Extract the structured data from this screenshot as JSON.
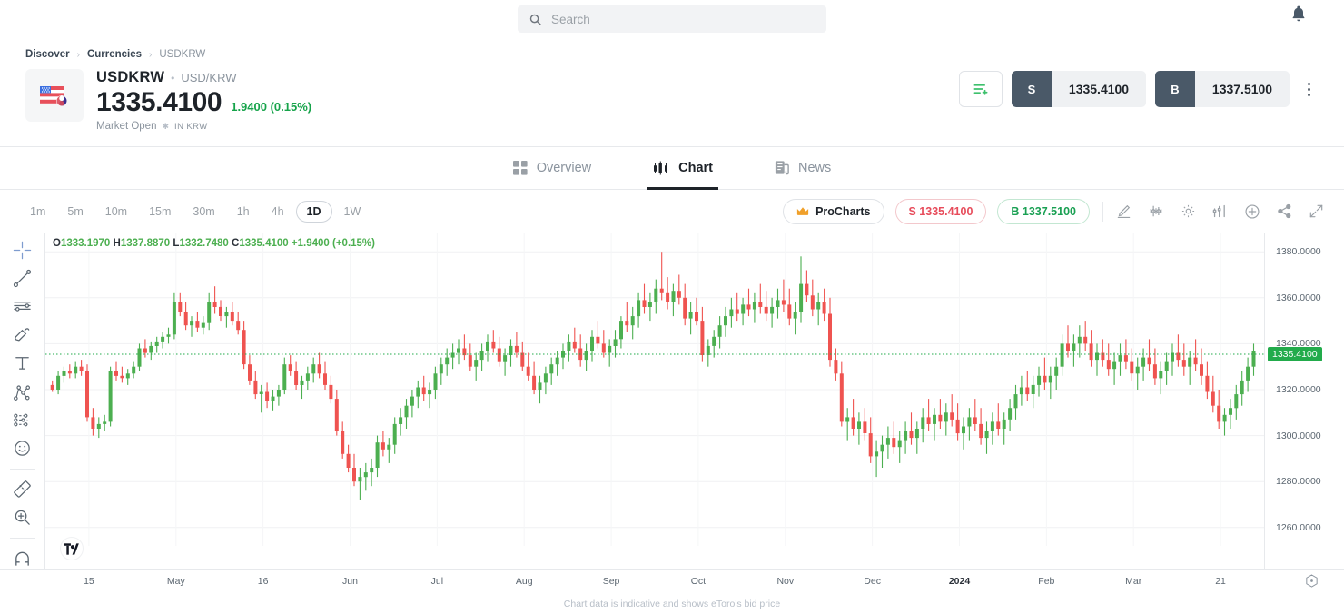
{
  "topbar": {
    "search_placeholder": "Search",
    "search_icon": "search-icon",
    "bell_icon": "notification-bell-icon"
  },
  "breadcrumb": {
    "items": [
      "Discover",
      "Currencies",
      "USDKRW"
    ],
    "separator": "›"
  },
  "instrument": {
    "ticker": "USDKRW",
    "separator": "•",
    "pair": "USD/KRW",
    "price": "1335.4100",
    "change": "1.9400 (0.15%)",
    "change_color": "#16a34a",
    "market_status": "Market Open",
    "status_marker": "✱",
    "currency_note": "IN KRW",
    "logo_icon": "usd-krw-flag-icon"
  },
  "trade": {
    "watchlist_icon": "add-to-watchlist-icon",
    "sell_letter": "S",
    "sell_price": "1335.4100",
    "buy_letter": "B",
    "buy_price": "1337.5100",
    "kebab_icon": "more-options-icon"
  },
  "tabs": [
    {
      "label": "Overview",
      "icon": "grid-icon",
      "active": false
    },
    {
      "label": "Chart",
      "icon": "candlestick-icon",
      "active": true
    },
    {
      "label": "News",
      "icon": "news-document-icon",
      "active": false
    }
  ],
  "chart_toolbar": {
    "timeframes": [
      "1m",
      "5m",
      "10m",
      "15m",
      "30m",
      "1h",
      "4h",
      "1D",
      "1W"
    ],
    "active_timeframe": "1D",
    "procharts_label": "ProCharts",
    "procharts_icon": "crown-icon",
    "sell_pill": "S 1335.4100",
    "buy_pill": "B 1337.5100",
    "icons": [
      "draw-pencil-icon",
      "indicators-icon",
      "settings-gear-icon",
      "chart-type-icon",
      "add-compare-icon",
      "share-icon",
      "fullscreen-icon"
    ]
  },
  "left_tools": [
    "crosshair-icon",
    "trend-line-icon",
    "horizontal-lines-icon",
    "brush-icon",
    "text-tool-icon",
    "fib-pitchfork-icon",
    "pattern-icon",
    "emoji-icon",
    "measure-ruler-icon",
    "zoom-in-icon",
    "magnet-icon"
  ],
  "chart_footnote": "Chart data is indicative and shows eToro's bid price",
  "tradingview_logo": "tradingview-logo-icon",
  "chart_data": {
    "type": "candlestick",
    "title": "USDKRW Daily Candlestick Chart",
    "symbol": "USDKRW",
    "interval": "1D",
    "ylabel": "",
    "xlabel": "",
    "ylim": [
      1252,
      1388
    ],
    "y_ticks": [
      "1380.0000",
      "1360.0000",
      "1340.0000",
      "1320.0000",
      "1300.0000",
      "1280.0000",
      "1260.0000"
    ],
    "y_tick_values": [
      1380,
      1360,
      1340,
      1320,
      1300,
      1280,
      1260
    ],
    "x_ticks": [
      "15",
      "May",
      "16",
      "Jun",
      "Jul",
      "Aug",
      "Sep",
      "Oct",
      "Nov",
      "Dec",
      "2024",
      "Feb",
      "Mar",
      "21"
    ],
    "x_tick_bold": [
      "2024"
    ],
    "grid": true,
    "current_price": 1335.41,
    "current_price_label": "1335.4100",
    "current_price_color": "#22ab4b",
    "up_color": "#4caf50",
    "down_color": "#ef5350",
    "legend": {
      "open_label": "O",
      "open": "1333.1970",
      "high_label": "H",
      "high": "1337.8870",
      "low_label": "L",
      "low": "1332.7480",
      "close_label": "C",
      "close": "1335.4100",
      "change": "+1.9400 (+0.15%)"
    },
    "ohlc": [
      [
        1322,
        1324,
        1319,
        1320
      ],
      [
        1320,
        1328,
        1318,
        1326
      ],
      [
        1326,
        1330,
        1323,
        1328
      ],
      [
        1328,
        1331,
        1325,
        1327
      ],
      [
        1327,
        1332,
        1325,
        1330
      ],
      [
        1330,
        1333,
        1326,
        1328
      ],
      [
        1328,
        1331,
        1306,
        1308
      ],
      [
        1308,
        1312,
        1300,
        1303
      ],
      [
        1303,
        1308,
        1299,
        1305
      ],
      [
        1305,
        1309,
        1302,
        1306
      ],
      [
        1306,
        1330,
        1304,
        1328
      ],
      [
        1328,
        1332,
        1324,
        1326
      ],
      [
        1326,
        1330,
        1323,
        1325
      ],
      [
        1325,
        1329,
        1322,
        1327
      ],
      [
        1327,
        1332,
        1325,
        1330
      ],
      [
        1330,
        1340,
        1328,
        1338
      ],
      [
        1338,
        1342,
        1334,
        1336
      ],
      [
        1336,
        1341,
        1333,
        1339
      ],
      [
        1339,
        1343,
        1336,
        1341
      ],
      [
        1341,
        1345,
        1338,
        1343
      ],
      [
        1343,
        1347,
        1340,
        1344
      ],
      [
        1344,
        1362,
        1342,
        1358
      ],
      [
        1358,
        1362,
        1352,
        1354
      ],
      [
        1354,
        1358,
        1346,
        1348
      ],
      [
        1348,
        1352,
        1343,
        1350
      ],
      [
        1350,
        1354,
        1345,
        1347
      ],
      [
        1347,
        1352,
        1344,
        1349
      ],
      [
        1349,
        1362,
        1346,
        1358
      ],
      [
        1358,
        1365,
        1353,
        1356
      ],
      [
        1356,
        1359,
        1350,
        1352
      ],
      [
        1352,
        1356,
        1347,
        1354
      ],
      [
        1354,
        1358,
        1348,
        1350
      ],
      [
        1350,
        1354,
        1344,
        1346
      ],
      [
        1346,
        1350,
        1329,
        1331
      ],
      [
        1331,
        1335,
        1322,
        1324
      ],
      [
        1324,
        1328,
        1316,
        1318
      ],
      [
        1318,
        1322,
        1310,
        1319
      ],
      [
        1319,
        1323,
        1312,
        1315
      ],
      [
        1315,
        1320,
        1311,
        1317
      ],
      [
        1317,
        1322,
        1313,
        1320
      ],
      [
        1320,
        1334,
        1318,
        1331
      ],
      [
        1331,
        1335,
        1326,
        1328
      ],
      [
        1328,
        1332,
        1320,
        1322
      ],
      [
        1322,
        1326,
        1316,
        1324
      ],
      [
        1324,
        1330,
        1320,
        1327
      ],
      [
        1327,
        1334,
        1323,
        1331
      ],
      [
        1331,
        1336,
        1325,
        1327
      ],
      [
        1327,
        1332,
        1320,
        1322
      ],
      [
        1322,
        1326,
        1314,
        1316
      ],
      [
        1316,
        1320,
        1300,
        1302
      ],
      [
        1302,
        1306,
        1290,
        1292
      ],
      [
        1292,
        1296,
        1284,
        1286
      ],
      [
        1286,
        1292,
        1278,
        1280
      ],
      [
        1280,
        1286,
        1272,
        1282
      ],
      [
        1282,
        1288,
        1276,
        1284
      ],
      [
        1284,
        1290,
        1278,
        1286
      ],
      [
        1286,
        1300,
        1282,
        1297
      ],
      [
        1297,
        1302,
        1291,
        1294
      ],
      [
        1294,
        1299,
        1288,
        1296
      ],
      [
        1296,
        1308,
        1292,
        1305
      ],
      [
        1305,
        1312,
        1300,
        1308
      ],
      [
        1308,
        1316,
        1303,
        1313
      ],
      [
        1313,
        1320,
        1308,
        1317
      ],
      [
        1317,
        1324,
        1312,
        1321
      ],
      [
        1321,
        1326,
        1315,
        1318
      ],
      [
        1318,
        1323,
        1312,
        1320
      ],
      [
        1320,
        1330,
        1316,
        1327
      ],
      [
        1327,
        1334,
        1322,
        1331
      ],
      [
        1331,
        1338,
        1326,
        1334
      ],
      [
        1334,
        1340,
        1329,
        1336
      ],
      [
        1336,
        1342,
        1331,
        1338
      ],
      [
        1338,
        1344,
        1333,
        1335
      ],
      [
        1335,
        1340,
        1328,
        1330
      ],
      [
        1330,
        1336,
        1324,
        1333
      ],
      [
        1333,
        1340,
        1328,
        1337
      ],
      [
        1337,
        1344,
        1332,
        1341
      ],
      [
        1341,
        1346,
        1336,
        1338
      ],
      [
        1338,
        1343,
        1330,
        1332
      ],
      [
        1332,
        1338,
        1326,
        1335
      ],
      [
        1335,
        1342,
        1330,
        1339
      ],
      [
        1339,
        1345,
        1334,
        1336
      ],
      [
        1336,
        1341,
        1328,
        1330
      ],
      [
        1330,
        1336,
        1324,
        1326
      ],
      [
        1326,
        1332,
        1318,
        1320
      ],
      [
        1320,
        1326,
        1314,
        1323
      ],
      [
        1323,
        1330,
        1318,
        1327
      ],
      [
        1327,
        1334,
        1322,
        1331
      ],
      [
        1331,
        1337,
        1326,
        1334
      ],
      [
        1334,
        1340,
        1329,
        1337
      ],
      [
        1337,
        1344,
        1332,
        1341
      ],
      [
        1341,
        1347,
        1336,
        1338
      ],
      [
        1338,
        1344,
        1330,
        1333
      ],
      [
        1333,
        1340,
        1328,
        1337
      ],
      [
        1337,
        1346,
        1332,
        1343
      ],
      [
        1343,
        1350,
        1338,
        1340
      ],
      [
        1340,
        1346,
        1334,
        1336
      ],
      [
        1336,
        1342,
        1330,
        1339
      ],
      [
        1339,
        1346,
        1334,
        1342
      ],
      [
        1342,
        1352,
        1338,
        1350
      ],
      [
        1350,
        1358,
        1345,
        1348
      ],
      [
        1348,
        1356,
        1342,
        1352
      ],
      [
        1352,
        1362,
        1347,
        1359
      ],
      [
        1359,
        1366,
        1353,
        1356
      ],
      [
        1356,
        1362,
        1350,
        1358
      ],
      [
        1358,
        1368,
        1353,
        1364
      ],
      [
        1364,
        1380,
        1359,
        1362
      ],
      [
        1362,
        1369,
        1355,
        1358
      ],
      [
        1358,
        1366,
        1352,
        1363
      ],
      [
        1363,
        1370,
        1357,
        1360
      ],
      [
        1360,
        1366,
        1348,
        1351
      ],
      [
        1351,
        1358,
        1344,
        1354
      ],
      [
        1354,
        1360,
        1348,
        1350
      ],
      [
        1350,
        1356,
        1332,
        1335
      ],
      [
        1335,
        1342,
        1330,
        1339
      ],
      [
        1339,
        1346,
        1334,
        1343
      ],
      [
        1343,
        1352,
        1338,
        1348
      ],
      [
        1348,
        1356,
        1343,
        1352
      ],
      [
        1352,
        1360,
        1347,
        1355
      ],
      [
        1355,
        1362,
        1350,
        1353
      ],
      [
        1353,
        1360,
        1348,
        1357
      ],
      [
        1357,
        1364,
        1352,
        1355
      ],
      [
        1355,
        1362,
        1349,
        1358
      ],
      [
        1358,
        1366,
        1353,
        1356
      ],
      [
        1356,
        1363,
        1350,
        1353
      ],
      [
        1353,
        1360,
        1347,
        1356
      ],
      [
        1356,
        1364,
        1351,
        1359
      ],
      [
        1359,
        1368,
        1354,
        1357
      ],
      [
        1357,
        1364,
        1348,
        1351
      ],
      [
        1351,
        1358,
        1344,
        1354
      ],
      [
        1354,
        1378,
        1349,
        1366
      ],
      [
        1366,
        1372,
        1358,
        1361
      ],
      [
        1361,
        1368,
        1352,
        1355
      ],
      [
        1355,
        1362,
        1348,
        1358
      ],
      [
        1358,
        1364,
        1350,
        1353
      ],
      [
        1353,
        1360,
        1330,
        1333
      ],
      [
        1333,
        1338,
        1324,
        1327
      ],
      [
        1327,
        1332,
        1304,
        1306
      ],
      [
        1306,
        1312,
        1298,
        1308
      ],
      [
        1308,
        1316,
        1300,
        1303
      ],
      [
        1303,
        1310,
        1296,
        1306
      ],
      [
        1306,
        1312,
        1298,
        1301
      ],
      [
        1301,
        1308,
        1288,
        1291
      ],
      [
        1291,
        1298,
        1282,
        1293
      ],
      [
        1293,
        1300,
        1286,
        1296
      ],
      [
        1296,
        1304,
        1290,
        1299
      ],
      [
        1299,
        1306,
        1292,
        1295
      ],
      [
        1295,
        1302,
        1288,
        1298
      ],
      [
        1298,
        1306,
        1292,
        1302
      ],
      [
        1302,
        1310,
        1296,
        1299
      ],
      [
        1299,
        1306,
        1292,
        1303
      ],
      [
        1303,
        1312,
        1297,
        1308
      ],
      [
        1308,
        1316,
        1302,
        1305
      ],
      [
        1305,
        1312,
        1298,
        1309
      ],
      [
        1309,
        1316,
        1303,
        1306
      ],
      [
        1306,
        1314,
        1300,
        1310
      ],
      [
        1310,
        1318,
        1304,
        1307
      ],
      [
        1307,
        1314,
        1298,
        1301
      ],
      [
        1301,
        1308,
        1294,
        1304
      ],
      [
        1304,
        1312,
        1298,
        1308
      ],
      [
        1308,
        1316,
        1302,
        1305
      ],
      [
        1305,
        1312,
        1296,
        1299
      ],
      [
        1299,
        1306,
        1292,
        1302
      ],
      [
        1302,
        1310,
        1296,
        1306
      ],
      [
        1306,
        1314,
        1300,
        1303
      ],
      [
        1303,
        1310,
        1296,
        1307
      ],
      [
        1307,
        1316,
        1302,
        1312
      ],
      [
        1312,
        1322,
        1307,
        1318
      ],
      [
        1318,
        1326,
        1313,
        1321
      ],
      [
        1321,
        1328,
        1315,
        1318
      ],
      [
        1318,
        1326,
        1312,
        1322
      ],
      [
        1322,
        1330,
        1317,
        1326
      ],
      [
        1326,
        1334,
        1320,
        1323
      ],
      [
        1323,
        1330,
        1316,
        1326
      ],
      [
        1326,
        1334,
        1320,
        1330
      ],
      [
        1330,
        1344,
        1326,
        1340
      ],
      [
        1340,
        1348,
        1334,
        1337
      ],
      [
        1337,
        1344,
        1330,
        1340
      ],
      [
        1340,
        1348,
        1334,
        1343
      ],
      [
        1343,
        1350,
        1337,
        1340
      ],
      [
        1340,
        1346,
        1330,
        1333
      ],
      [
        1333,
        1340,
        1326,
        1336
      ],
      [
        1336,
        1342,
        1330,
        1333
      ],
      [
        1333,
        1340,
        1326,
        1329
      ],
      [
        1329,
        1336,
        1322,
        1332
      ],
      [
        1332,
        1340,
        1326,
        1335
      ],
      [
        1335,
        1342,
        1329,
        1332
      ],
      [
        1332,
        1338,
        1324,
        1327
      ],
      [
        1327,
        1334,
        1320,
        1330
      ],
      [
        1330,
        1338,
        1324,
        1334
      ],
      [
        1334,
        1342,
        1328,
        1331
      ],
      [
        1331,
        1338,
        1322,
        1325
      ],
      [
        1325,
        1332,
        1318,
        1328
      ],
      [
        1328,
        1336,
        1322,
        1332
      ],
      [
        1332,
        1340,
        1326,
        1336
      ],
      [
        1336,
        1344,
        1330,
        1333
      ],
      [
        1333,
        1340,
        1326,
        1330
      ],
      [
        1330,
        1337,
        1322,
        1334
      ],
      [
        1334,
        1342,
        1328,
        1331
      ],
      [
        1331,
        1338,
        1322,
        1326
      ],
      [
        1326,
        1332,
        1316,
        1319
      ],
      [
        1319,
        1326,
        1310,
        1313
      ],
      [
        1313,
        1320,
        1303,
        1306
      ],
      [
        1306,
        1312,
        1300,
        1309
      ],
      [
        1309,
        1316,
        1303,
        1312
      ],
      [
        1312,
        1322,
        1307,
        1318
      ],
      [
        1318,
        1328,
        1313,
        1324
      ],
      [
        1324,
        1334,
        1319,
        1330
      ],
      [
        1330,
        1340,
        1326,
        1337
      ]
    ]
  }
}
